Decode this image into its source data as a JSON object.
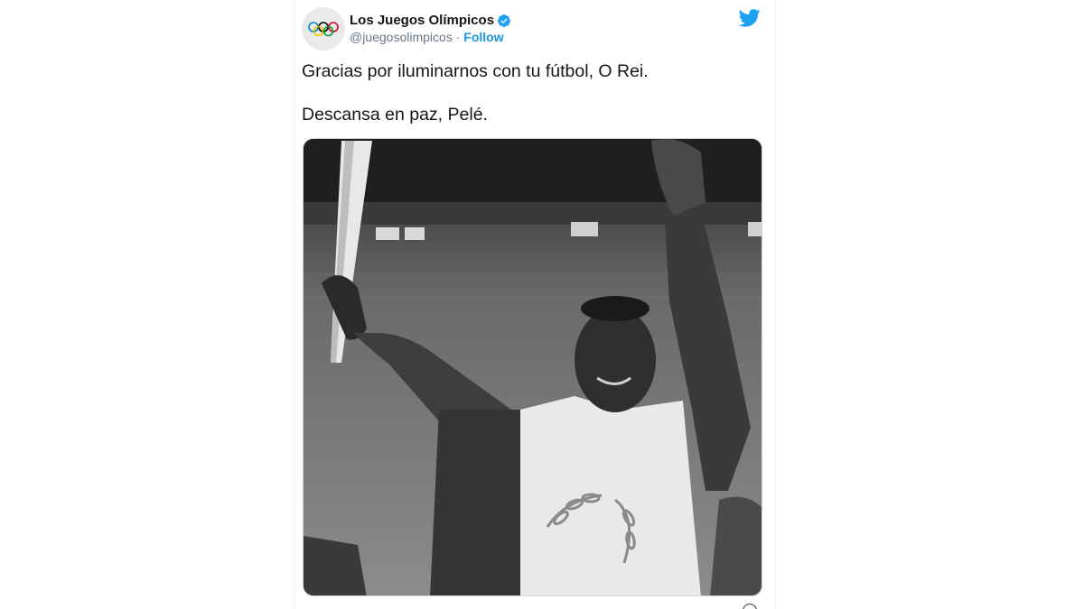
{
  "tweet": {
    "display_name": "Los Juegos Olímpicos",
    "handle": "@juegosolimpicos",
    "separator": "·",
    "follow_label": "Follow",
    "lines": [
      "Gracias por iluminarnos con tu fútbol, O Rei.",
      "Descansa en paz, Pelé."
    ]
  },
  "icons": {
    "avatar": "olympic-rings-icon",
    "verified": "verified-badge-icon",
    "brand": "twitter-bird-icon",
    "info": "info-icon"
  },
  "colors": {
    "accent": "#1b95e0",
    "verified": "#1da1f2",
    "text": "#14171a",
    "secondary": "#657786"
  }
}
